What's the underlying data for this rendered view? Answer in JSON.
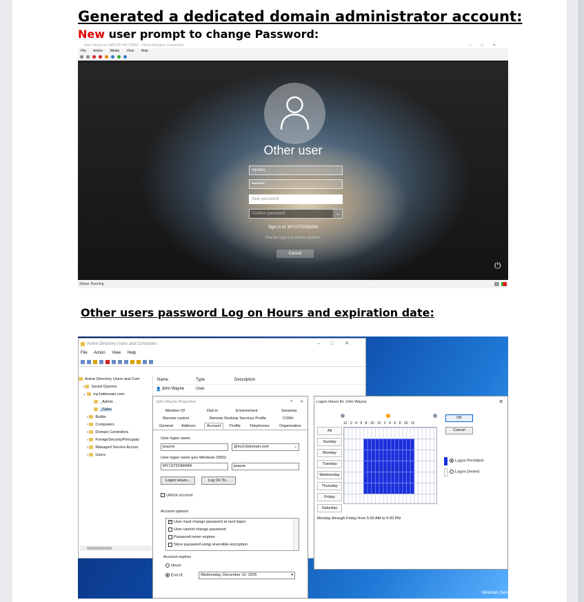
{
  "document": {
    "heading1": "Generated a dedicated domain administrator account:",
    "heading2_new": "New",
    "heading2_rest": " user prompt to change Password:",
    "heading3": "Other users password Log on Hours and expiration date:"
  },
  "vm": {
    "window_title": "New Virtual on LAPTOP-HK7199F8 - Virtual Machine Connection",
    "menu": [
      "File",
      "Action",
      "Media",
      "View",
      "Help"
    ],
    "login": {
      "title": "Other user",
      "username": "mjones",
      "password_mask": "•••••••••",
      "new_password_placeholder": "New password",
      "confirm_password_placeholder": "Confirm password",
      "confirm_arrow": "→",
      "sign_in_to": "Sign in to: MY1STDOMAIN",
      "other_domain_link": "How do I sign in to another domain?",
      "cancel": "Cancel"
    },
    "status": "Status: Running"
  },
  "ad": {
    "window_title": "Active Directory Users and Computers",
    "menu": [
      "File",
      "Action",
      "View",
      "Help"
    ],
    "tree": {
      "root": "Active Directory Users and Com",
      "saved_queries": "Saved Queries",
      "domain": "my1stdomain.com",
      "items": [
        "_Admin",
        "_Sales",
        "Builtin",
        "Computers",
        "Domain Controllers",
        "ForeignSecurityPrincipals",
        "Managed Service Accour",
        "Users"
      ]
    },
    "list": {
      "headers": [
        "Name",
        "Type",
        "Description"
      ],
      "row": {
        "name": "John Wayne",
        "type": "User"
      }
    },
    "props": {
      "title": "John Wayne Properties",
      "help": "?",
      "close": "✕",
      "tabs_row1": [
        "Member Of",
        "Dial-in",
        "Environment",
        "Sessions"
      ],
      "tabs_row2": [
        "Remote control",
        "Remote Desktop Services Profile",
        "COM+"
      ],
      "tabs_row3": [
        "General",
        "Address",
        "Account",
        "Profile",
        "Telephones",
        "Organization"
      ],
      "logon_name_label": "User logon name:",
      "logon_name": "jwayne",
      "upn_suffix": "@my1stdomain.com",
      "pre2000_label": "User logon name (pre-Windows 2000):",
      "pre2000_domain": "MY1STDOMAIN\\",
      "pre2000_user": "jwayne",
      "logon_hours_btn": "Logon Hours...",
      "logon_to_btn": "Log On To...",
      "unlock": "Unlock account",
      "options_label": "Account options:",
      "options": [
        {
          "label": "User must change password at next logon",
          "checked": true
        },
        {
          "label": "User cannot change password",
          "checked": false
        },
        {
          "label": "Password never expires",
          "checked": false
        },
        {
          "label": "Store password using reversible encryption",
          "checked": false
        }
      ],
      "expires_label": "Account expires",
      "never": "Never",
      "end_of": "End of:",
      "end_date": "Wednesday, December 10, 2025"
    },
    "hours": {
      "title": "Logon Hours for John Wayne",
      "close": "✕",
      "scale": "12 · 2 · 4 · 6 · 8 · 10 · 12 · 2 · 4 · 6 · 8 · 10 · 12",
      "all": "All",
      "days": [
        "Sunday",
        "Monday",
        "Tuesday",
        "Wednesday",
        "Thursday",
        "Friday",
        "Saturday"
      ],
      "ok": "OK",
      "cancel": "Cancel",
      "permitted": "Logon Permitted",
      "denied": "Logon Denied",
      "caption": "Monday through Friday from 5:00 AM to 6:00 PM",
      "permitted_color": "#1a2fd9"
    },
    "taskbar_text": "Windows Serv"
  }
}
